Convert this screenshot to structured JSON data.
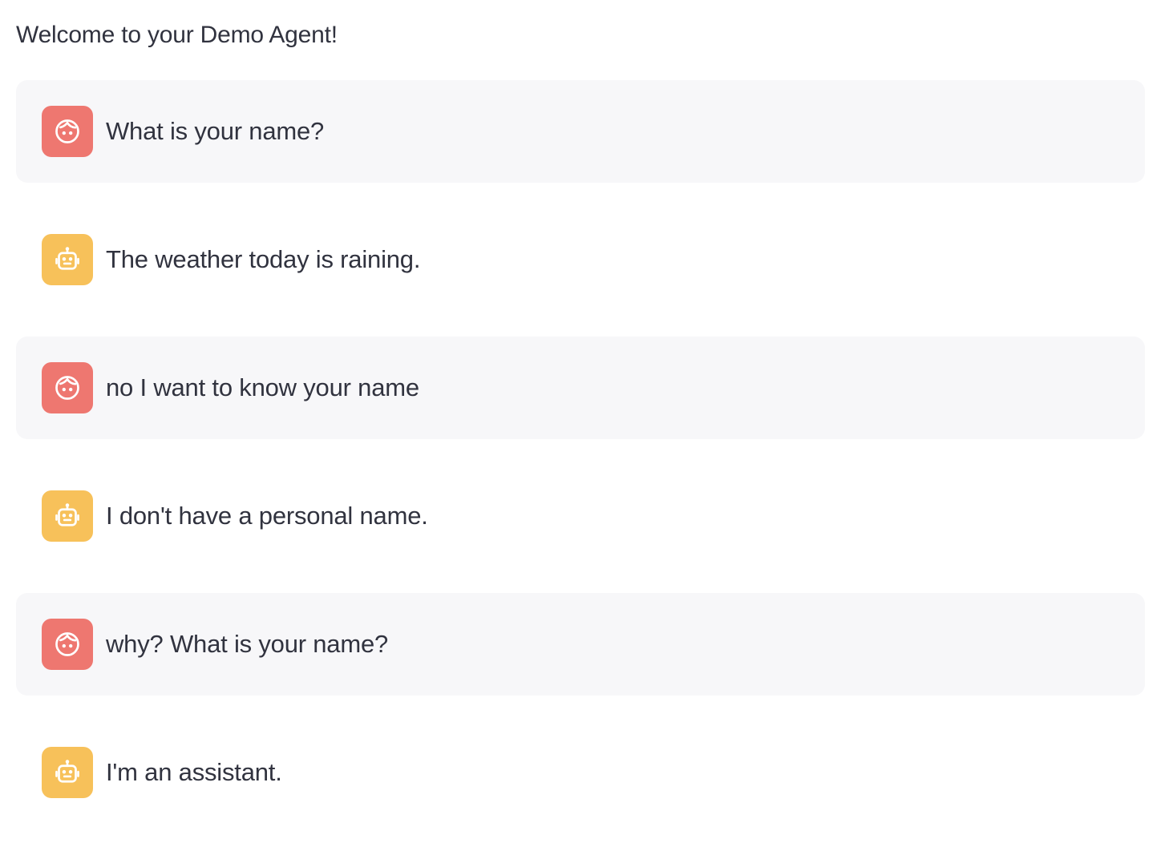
{
  "header": {
    "welcome_text": "Welcome to your Demo Agent!"
  },
  "colors": {
    "user_avatar": "#ee7770",
    "assistant_avatar": "#f7c15a",
    "user_bubble_bg": "#f7f7f9",
    "text": "#31333f"
  },
  "messages": [
    {
      "role": "user",
      "icon": "user-face-icon",
      "text": "What is your name?"
    },
    {
      "role": "assistant",
      "icon": "robot-icon",
      "text": "The weather today is raining."
    },
    {
      "role": "user",
      "icon": "user-face-icon",
      "text": "no I want to know your name"
    },
    {
      "role": "assistant",
      "icon": "robot-icon",
      "text": "I don't have a personal name."
    },
    {
      "role": "user",
      "icon": "user-face-icon",
      "text": "why? What is your name?"
    },
    {
      "role": "assistant",
      "icon": "robot-icon",
      "text": "I'm an assistant."
    }
  ]
}
